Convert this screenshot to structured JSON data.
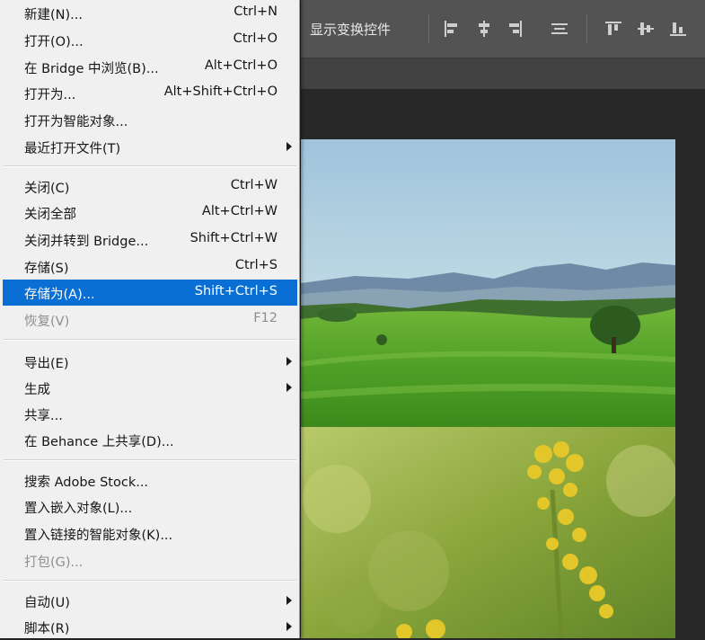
{
  "menu": {
    "items": [
      {
        "label": "新建(N)...",
        "shortcut": "Ctrl+N"
      },
      {
        "label": "打开(O)...",
        "shortcut": "Ctrl+O"
      },
      {
        "label": "在 Bridge 中浏览(B)...",
        "shortcut": "Alt+Ctrl+O"
      },
      {
        "label": "打开为...",
        "shortcut": "Alt+Shift+Ctrl+O"
      },
      {
        "label": "打开为智能对象...",
        "shortcut": ""
      },
      {
        "label": "最近打开文件(T)",
        "shortcut": "",
        "submenu": true
      },
      {
        "label": "关闭(C)",
        "shortcut": "Ctrl+W"
      },
      {
        "label": "关闭全部",
        "shortcut": "Alt+Ctrl+W"
      },
      {
        "label": "关闭并转到 Bridge...",
        "shortcut": "Shift+Ctrl+W"
      },
      {
        "label": "存储(S)",
        "shortcut": "Ctrl+S"
      },
      {
        "label": "存储为(A)...",
        "shortcut": "Shift+Ctrl+S",
        "highlighted": true
      },
      {
        "label": "恢复(V)",
        "shortcut": "F12",
        "disabled": true
      },
      {
        "label": "导出(E)",
        "shortcut": "",
        "submenu": true
      },
      {
        "label": "生成",
        "shortcut": "",
        "submenu": true
      },
      {
        "label": "共享...",
        "shortcut": ""
      },
      {
        "label": "在 Behance 上共享(D)...",
        "shortcut": ""
      },
      {
        "label": "搜索 Adobe Stock...",
        "shortcut": ""
      },
      {
        "label": "置入嵌入对象(L)...",
        "shortcut": ""
      },
      {
        "label": "置入链接的智能对象(K)...",
        "shortcut": ""
      },
      {
        "label": "打包(G)...",
        "shortcut": "",
        "disabled": true
      },
      {
        "label": "自动(U)",
        "shortcut": "",
        "submenu": true
      },
      {
        "label": "脚本(R)",
        "shortcut": "",
        "submenu": true
      }
    ]
  },
  "options_bar": {
    "show_transform_controls": "显示变换控件",
    "icons": [
      "align-left-icon",
      "align-hcenter-icon",
      "align-right-icon",
      "distribute-icon",
      "align-top-icon",
      "align-vcenter-icon",
      "align-bottom-icon"
    ]
  },
  "colors": {
    "menu_bg": "#f0f0f0",
    "highlight": "#0a6fd5",
    "app_bg": "#282828",
    "options_bar": "#535353"
  }
}
